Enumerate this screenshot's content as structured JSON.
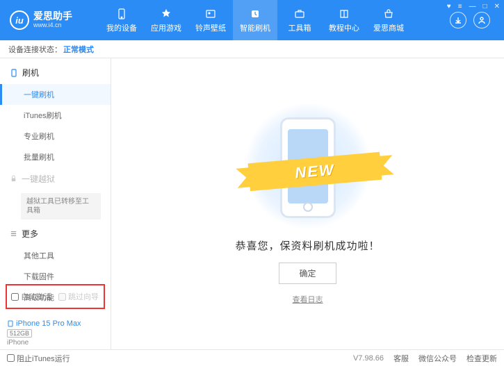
{
  "brand": {
    "title": "爱思助手",
    "subtitle": "www.i4.cn",
    "logo_letter": "iu"
  },
  "topnav": {
    "items": [
      {
        "label": "我的设备"
      },
      {
        "label": "应用游戏"
      },
      {
        "label": "铃声壁纸"
      },
      {
        "label": "智能刷机"
      },
      {
        "label": "工具箱"
      },
      {
        "label": "教程中心"
      },
      {
        "label": "爱思商城"
      }
    ]
  },
  "status": {
    "label": "设备连接状态：",
    "value": "正常模式"
  },
  "sidebar": {
    "section_flash": "刷机",
    "items_flash": [
      "一键刷机",
      "iTunes刷机",
      "专业刷机",
      "批量刷机"
    ],
    "section_jailbreak": "一键越狱",
    "jailbreak_note": "越狱工具已转移至工具箱",
    "section_more": "更多",
    "items_more": [
      "其他工具",
      "下载固件",
      "高级功能"
    ],
    "checkbox1": "自动激活",
    "checkbox2": "跳过向导"
  },
  "device": {
    "name": "iPhone 15 Pro Max",
    "storage": "512GB",
    "type": "iPhone"
  },
  "main": {
    "ribbon": "NEW",
    "message": "恭喜您，保资料刷机成功啦！",
    "ok": "确定",
    "view_log": "查看日志"
  },
  "footer": {
    "block_itunes": "阻止iTunes运行",
    "version": "V7.98.66",
    "links": [
      "客服",
      "微信公众号",
      "检查更新"
    ]
  }
}
